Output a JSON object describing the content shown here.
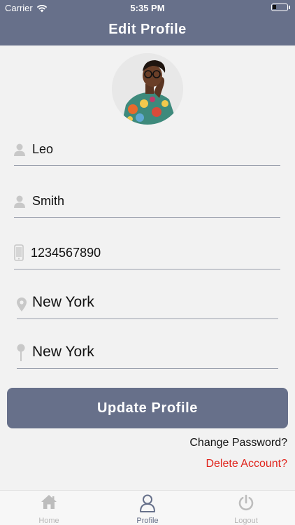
{
  "status_bar": {
    "carrier": "Carrier",
    "time": "5:35 PM"
  },
  "header": {
    "title": "Edit Profile"
  },
  "colors": {
    "primary": "#67708a",
    "danger": "#e0241c",
    "background": "#f2f2f2"
  },
  "avatar": {
    "alt": "Profile photo"
  },
  "form": {
    "first_name": {
      "value": "Leo",
      "icon": "person-icon"
    },
    "last_name": {
      "value": "Smith",
      "icon": "person-icon"
    },
    "phone": {
      "value": "1234567890",
      "icon": "phone-icon"
    },
    "city": {
      "value": "New York",
      "icon": "location-pin-icon"
    },
    "state": {
      "value": "New York",
      "icon": "map-pin-icon"
    }
  },
  "actions": {
    "update_label": "Update Profile",
    "change_password": "Change Password?",
    "delete_account": "Delete Account?"
  },
  "tabs": [
    {
      "label": "Home",
      "icon": "home-icon",
      "active": false
    },
    {
      "label": "Profile",
      "icon": "profile-icon",
      "active": true
    },
    {
      "label": "Logout",
      "icon": "power-icon",
      "active": false
    }
  ]
}
